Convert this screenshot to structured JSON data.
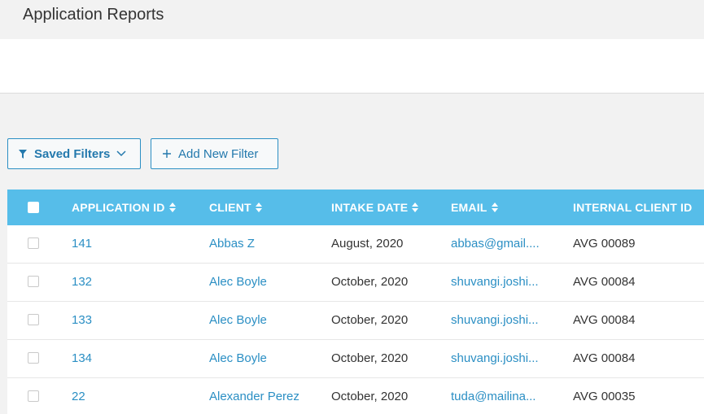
{
  "page": {
    "title": "Application Reports"
  },
  "filters": {
    "saved_label": "Saved Filters",
    "add_label": "Add New Filter"
  },
  "table": {
    "headers": {
      "application_id": "APPLICATION ID",
      "client": "CLIENT",
      "intake_date": "INTAKE DATE",
      "email": "EMAIL",
      "internal_client_id": "INTERNAL CLIENT ID"
    },
    "rows": [
      {
        "application_id": "141",
        "client": "Abbas Z",
        "intake_date": "August, 2020",
        "email": "abbas@gmail....",
        "internal_client_id": "AVG 00089"
      },
      {
        "application_id": "132",
        "client": "Alec Boyle",
        "intake_date": "October, 2020",
        "email": "shuvangi.joshi...",
        "internal_client_id": "AVG 00084"
      },
      {
        "application_id": "133",
        "client": "Alec Boyle",
        "intake_date": "October, 2020",
        "email": "shuvangi.joshi...",
        "internal_client_id": "AVG 00084"
      },
      {
        "application_id": "134",
        "client": "Alec Boyle",
        "intake_date": "October, 2020",
        "email": "shuvangi.joshi...",
        "internal_client_id": "AVG 00084"
      },
      {
        "application_id": "22",
        "client": "Alexander Perez",
        "intake_date": "October, 2020",
        "email": "tuda@mailina...",
        "internal_client_id": "AVG 00035"
      }
    ]
  },
  "colors": {
    "header_bg": "#56bde9",
    "link": "#2b8fc4",
    "button_border": "#2b8fc4"
  },
  "icons": {
    "filter": "funnel-icon",
    "chevron": "chevron-down-icon",
    "plus": "plus-icon",
    "sort": "sort-icon"
  }
}
